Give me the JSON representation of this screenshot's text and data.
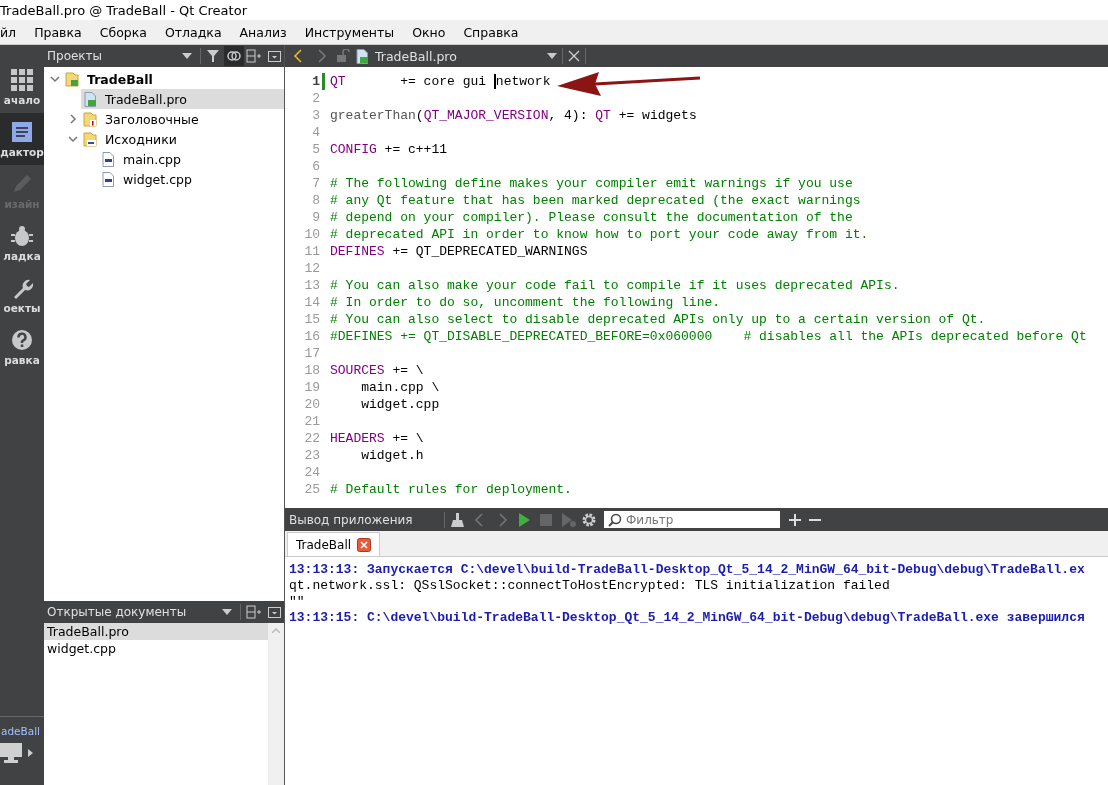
{
  "window": {
    "title": "TradeBall.pro @ TradeBall - Qt Creator"
  },
  "menu": [
    "йл",
    "Правка",
    "Сборка",
    "Отладка",
    "Анализ",
    "Инструменты",
    "Окно",
    "Справка"
  ],
  "modes": [
    {
      "label": "ачало",
      "kind": "grid",
      "selected": false,
      "disabled": false
    },
    {
      "label": "дактор",
      "kind": "editor",
      "selected": true,
      "disabled": false
    },
    {
      "label": "изайн",
      "kind": "pencil",
      "selected": false,
      "disabled": true
    },
    {
      "label": "ладка",
      "kind": "bug",
      "selected": false,
      "disabled": false
    },
    {
      "label": "оекты",
      "kind": "wrench",
      "selected": false,
      "disabled": false
    },
    {
      "label": "равка",
      "kind": "help",
      "selected": false,
      "disabled": false
    }
  ],
  "kit": {
    "label": "adeBall"
  },
  "projects": {
    "title": "Проекты",
    "tree": [
      {
        "label": "TradeBall",
        "kind": "project",
        "expanded": true,
        "selected": false,
        "children": [
          {
            "label": "TradeBall.pro",
            "kind": "pro",
            "selected": false,
            "current": true
          },
          {
            "label": "Заголовочные",
            "kind": "headers",
            "expanded": false,
            "selected": false,
            "current": false
          },
          {
            "label": "Исходники",
            "kind": "sources",
            "expanded": true,
            "selected": false,
            "current": false,
            "children": [
              {
                "label": "main.cpp",
                "kind": "cpp",
                "selected": false,
                "current": false
              },
              {
                "label": "widget.cpp",
                "kind": "cpp",
                "selected": false,
                "current": false
              }
            ]
          }
        ]
      }
    ]
  },
  "open_documents": {
    "title": "Открытые документы",
    "items": [
      {
        "label": "TradeBall.pro",
        "selected": true
      },
      {
        "label": "widget.cpp",
        "selected": false
      }
    ]
  },
  "editor": {
    "file": "TradeBall.pro",
    "lines": [
      {
        "number": "1",
        "current": true,
        "segments": [
          {
            "text": "QT",
            "kind": "keyword"
          },
          {
            "text": "       += core gui ",
            "kind": "plain"
          },
          {
            "kind": "cursor"
          },
          {
            "text": "network",
            "kind": "plain"
          }
        ]
      },
      {
        "number": "2",
        "current": false
      },
      {
        "number": "3",
        "current": false,
        "segments": [
          {
            "text": "greaterThan",
            "kind": "function"
          },
          {
            "text": "(",
            "kind": "plain"
          },
          {
            "text": "QT_MAJOR_VERSION",
            "kind": "keyword"
          },
          {
            "text": ", 4): ",
            "kind": "plain"
          },
          {
            "text": "QT",
            "kind": "keyword"
          },
          {
            "text": " += widgets",
            "kind": "plain"
          }
        ]
      },
      {
        "number": "4",
        "current": false
      },
      {
        "number": "5",
        "current": false,
        "segments": [
          {
            "text": "CONFIG",
            "kind": "keyword"
          },
          {
            "text": " += c++11",
            "kind": "plain"
          }
        ]
      },
      {
        "number": "6",
        "current": false
      },
      {
        "number": "7",
        "current": false,
        "segments": [
          {
            "text": "# The following define makes your compiler emit warnings if you use",
            "kind": "comment"
          }
        ]
      },
      {
        "number": "8",
        "current": false,
        "segments": [
          {
            "text": "# any Qt feature that has been marked deprecated (the exact warnings",
            "kind": "comment"
          }
        ]
      },
      {
        "number": "9",
        "current": false,
        "segments": [
          {
            "text": "# depend on your compiler). Please consult the documentation of the",
            "kind": "comment"
          }
        ]
      },
      {
        "number": "10",
        "current": false,
        "segments": [
          {
            "text": "# deprecated API in order to know how to port your code away from it.",
            "kind": "comment"
          }
        ]
      },
      {
        "number": "11",
        "current": false,
        "segments": [
          {
            "text": "DEFINES",
            "kind": "keyword"
          },
          {
            "text": " += QT_DEPRECATED_WARNINGS",
            "kind": "plain"
          }
        ]
      },
      {
        "number": "12",
        "current": false
      },
      {
        "number": "13",
        "current": false,
        "segments": [
          {
            "text": "# You can also make your code fail to compile if it uses deprecated APIs.",
            "kind": "comment"
          }
        ]
      },
      {
        "number": "14",
        "current": false,
        "segments": [
          {
            "text": "# In order to do so, uncomment the following line.",
            "kind": "comment"
          }
        ]
      },
      {
        "number": "15",
        "current": false,
        "segments": [
          {
            "text": "# You can also select to disable deprecated APIs only up to a certain version of Qt.",
            "kind": "comment"
          }
        ]
      },
      {
        "number": "16",
        "current": false,
        "segments": [
          {
            "text": "#DEFINES += QT_DISABLE_DEPRECATED_BEFORE=0x060000    # disables all the APIs deprecated before Qt",
            "kind": "comment"
          }
        ]
      },
      {
        "number": "17",
        "current": false
      },
      {
        "number": "18",
        "current": false,
        "segments": [
          {
            "text": "SOURCES",
            "kind": "keyword"
          },
          {
            "text": " += \\",
            "kind": "plain"
          }
        ]
      },
      {
        "number": "19",
        "current": false,
        "segments": [
          {
            "text": "    main.cpp \\",
            "kind": "plain"
          }
        ]
      },
      {
        "number": "20",
        "current": false,
        "segments": [
          {
            "text": "    widget.cpp",
            "kind": "plain"
          }
        ]
      },
      {
        "number": "21",
        "current": false
      },
      {
        "number": "22",
        "current": false,
        "segments": [
          {
            "text": "HEADERS",
            "kind": "keyword"
          },
          {
            "text": " += \\",
            "kind": "plain"
          }
        ]
      },
      {
        "number": "23",
        "current": false,
        "segments": [
          {
            "text": "    widget.h",
            "kind": "plain"
          }
        ]
      },
      {
        "number": "24",
        "current": false
      },
      {
        "number": "25",
        "current": false,
        "segments": [
          {
            "text": "# Default rules for deployment.",
            "kind": "comment"
          }
        ]
      }
    ]
  },
  "output": {
    "title": "Вывод приложения",
    "filter": {
      "placeholder": "Фильтр"
    },
    "tabs": [
      {
        "label": "TradeBall",
        "selected": true
      }
    ],
    "lines": [
      {
        "kind": "status",
        "text": "13:13:13: Запускается C:\\devel\\build-TradeBall-Desktop_Qt_5_14_2_MinGW_64_bit-Debug\\debug\\TradeBall.ex"
      },
      {
        "kind": "plain",
        "text": "qt.network.ssl: QSslSocket::connectToHostEncrypted: TLS initialization failed"
      },
      {
        "kind": "plain",
        "text": "\"\""
      },
      {
        "kind": "status",
        "text": "13:13:15: C:\\devel\\build-TradeBall-Desktop_Qt_5_14_2_MinGW_64_bit-Debug\\debug\\TradeBall.exe завершился"
      }
    ]
  }
}
